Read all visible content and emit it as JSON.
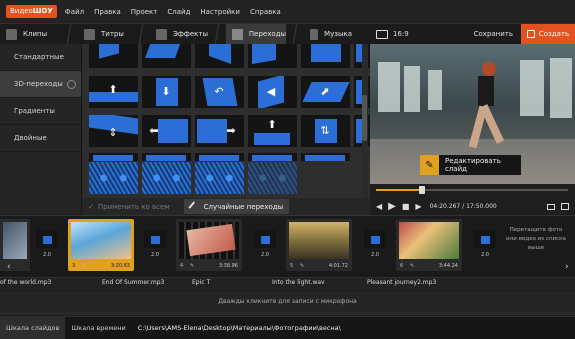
{
  "app": {
    "logo_part1": "Видео",
    "logo_part2": "ШОУ"
  },
  "menu": [
    "Файл",
    "Правка",
    "Проект",
    "Слайд",
    "Настройки",
    "Справка"
  ],
  "tabs": [
    {
      "label": "Клипы",
      "icon": "clips-icon"
    },
    {
      "label": "Титры",
      "icon": "titles-icon"
    },
    {
      "label": "Эффекты",
      "icon": "effects-icon"
    },
    {
      "label": "Переходы",
      "icon": "transitions-icon",
      "active": true
    },
    {
      "label": "Музыка",
      "icon": "music-icon"
    }
  ],
  "preview": {
    "aspect": "16:9",
    "save_label": "Сохранить",
    "create_label": "Создать",
    "edit_slide_label": "Редактировать слайд",
    "timecode": "04:20.267 / 17:50.000",
    "position_fraction": 0.24
  },
  "categories": [
    {
      "label": "Стандартные"
    },
    {
      "label": "3D-переходы",
      "selected": true
    },
    {
      "label": "Градиенты"
    },
    {
      "label": "Двойные"
    }
  ],
  "transitions_grid": {
    "rows": [
      [
        "flip-left",
        "corner-up",
        "fold",
        "fold-right",
        "fold-out",
        "page-turn-right"
      ],
      [
        "arrow-up",
        "arrow-down",
        "rotate-left",
        "cube-left",
        "arrow-up-right",
        "cube-corner"
      ],
      [
        "split-v",
        "arrow-left",
        "arrow-right",
        "arrow-up-small",
        "arrow-up-down",
        "arrow-left-small"
      ],
      [
        "arrow-up-bar",
        "arrow-left-bar",
        "arrow-right-bar",
        "arrow-up-long",
        "arrow-right-long",
        "arrow-left-long"
      ],
      [
        "pattern-hex",
        "pattern-ripple",
        "pattern-scatter",
        "pattern-dark",
        "",
        ""
      ]
    ]
  },
  "apply_all_label": "Применить ко всем",
  "random_label": "Случайные переходы",
  "timeline": {
    "slides": [
      {
        "num": "3",
        "duration": "3:20.83",
        "selected": true
      },
      {
        "num": "4",
        "duration": "3:38.96"
      },
      {
        "num": "5",
        "duration": "4:01.72"
      },
      {
        "num": "6",
        "duration": "3:44.24"
      }
    ],
    "transition_durations": [
      "2.0",
      "2.0",
      "2.0",
      "2.0",
      "2.0",
      "2.0"
    ],
    "drop_hint": "Перетащите фото или видео из списка выше",
    "audio": [
      "of the world.mp3",
      "End Of Summer.mp3",
      "Epic T",
      "Into the light.wav",
      "Pleasant journey2.mp3"
    ],
    "mic_hint": "Дважды кликните для записи с микрофона"
  },
  "status": {
    "tab_slides": "Шкала слайдов",
    "tab_time": "Шкала времени",
    "path": "C:\\Users\\AMS-Elena\\Desktop\\Материалы\\Фотографии\\весна\\"
  },
  "colors": {
    "accent": "#e2531f",
    "selection": "#e2a01f",
    "transition_blue": "#2b6fd6"
  }
}
